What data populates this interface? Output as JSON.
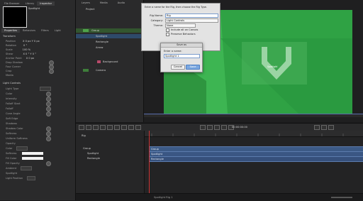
{
  "library": {
    "tabs": [
      "File Browser",
      "Library",
      "Inspector"
    ],
    "preview_title": "Spotlight",
    "prop_tabs": [
      "Properties",
      "Behaviors",
      "Filters",
      "Light"
    ],
    "transform_header": "Transform",
    "transform_rows": [
      {
        "label": "Position",
        "value": "X  0 px   Y  0 px"
      },
      {
        "label": "Rotation",
        "value": "0 °"
      },
      {
        "label": "Scale",
        "value": "100 %"
      },
      {
        "label": "Shear",
        "value": "X 0 °  Y 0 °"
      },
      {
        "label": "Anchor Point",
        "value": "X 0 px"
      },
      {
        "label": "Drop Shadow",
        "value": ""
      },
      {
        "label": "Four Corner",
        "value": ""
      },
      {
        "label": "Crop",
        "value": ""
      },
      {
        "label": "Media",
        "value": ""
      }
    ],
    "lower_header": "Light Controls",
    "lower_rows": [
      "Light Type",
      "Color",
      "Intensity",
      "Falloff Start",
      "Falloff",
      "Cone Angle",
      "Soft Edge",
      "Shadows",
      "Shadow Color",
      "Softness",
      "Uniform Softness",
      "Opacity",
      "Color",
      "Softness",
      "Fill Color",
      "Fill Opacity",
      "Ambient",
      "Spotlight",
      "Light Position"
    ]
  },
  "layers": {
    "headers": [
      "Layers",
      "Media",
      "Audio"
    ],
    "items": [
      {
        "name": "Project",
        "indent": 0
      },
      {
        "name": "Group",
        "indent": 1
      },
      {
        "name": "Spotlight",
        "indent": 2
      },
      {
        "name": "Rectangle",
        "indent": 2
      },
      {
        "name": "Arrow",
        "indent": 2
      },
      {
        "name": "Background",
        "indent": 1
      },
      {
        "name": "Camera",
        "indent": 1
      }
    ]
  },
  "canvas": {
    "bg_color": "#2fa244",
    "overlay_label": "Spotlight"
  },
  "dialog_main": {
    "title": "Enter a name for the Rig, then choose the Rig Type.",
    "rows": [
      {
        "label": "Rig Name:",
        "value": "Rig"
      },
      {
        "label": "Category:",
        "value": "Light Controls"
      },
      {
        "label": "Theme:",
        "value": "None"
      }
    ],
    "checkbox1": "Include all on Canvas",
    "checkbox2": "Preserve Behaviors"
  },
  "dialog_save": {
    "title": "Save as",
    "label": "Enter a name:",
    "value": "Spotlight 1",
    "cancel": "Cancel",
    "ok": "Save"
  },
  "timeline": {
    "project_label": "Rig",
    "tracks": [
      "Group",
      "Spotlight",
      "Rectangle",
      "Arrow"
    ],
    "timecode": "00:00:00:00"
  },
  "statusbar": {
    "text": "Spotlight   Rig 1"
  }
}
